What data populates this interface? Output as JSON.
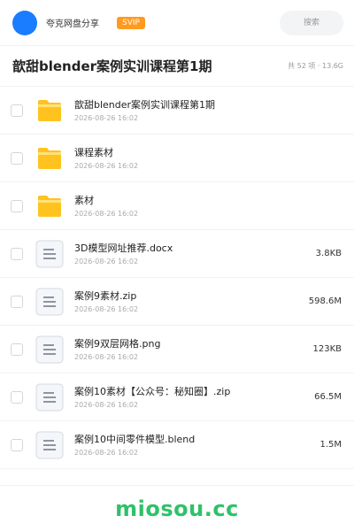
{
  "header": {
    "brand": "夸克网盘分享",
    "badge": "SVIP",
    "search_placeholder": "搜索",
    "accent_color": "#1a7cff",
    "badge_color": "#ff9a1f"
  },
  "title_bar": {
    "title": "歆甜blender案例实训课程第1期",
    "meta": "共 52 项 · 13.6G"
  },
  "files": [
    {
      "name": "歆甜blender案例实训课程第1期",
      "date": "2026-08-26 16:02",
      "size": "",
      "icon": "folder-icon"
    },
    {
      "name": "课程素材",
      "date": "2026-08-26 16:02",
      "size": "",
      "icon": "folder-icon"
    },
    {
      "name": "素材",
      "date": "2026-08-26 16:02",
      "size": "",
      "icon": "folder-icon"
    },
    {
      "name": "3D模型网址推荐.docx",
      "date": "2026-08-26 16:02",
      "size": "3.8KB",
      "icon": "document-icon"
    },
    {
      "name": "案例9素材.zip",
      "date": "2026-08-26 16:02",
      "size": "598.6M",
      "icon": "document-icon"
    },
    {
      "name": "案例9双层网格.png",
      "date": "2026-08-26 16:02",
      "size": "123KB",
      "icon": "document-icon"
    },
    {
      "name": "案例10素材【公众号：秘知圈】.zip",
      "date": "2026-08-26 16:02",
      "size": "66.5M",
      "icon": "document-icon"
    },
    {
      "name": "案例10中间零件模型.blend",
      "date": "2026-08-26 16:02",
      "size": "1.5M",
      "icon": "document-icon"
    }
  ],
  "footer": {
    "watermark": "miosou.cc",
    "watermark_color": "#2fc16a"
  }
}
